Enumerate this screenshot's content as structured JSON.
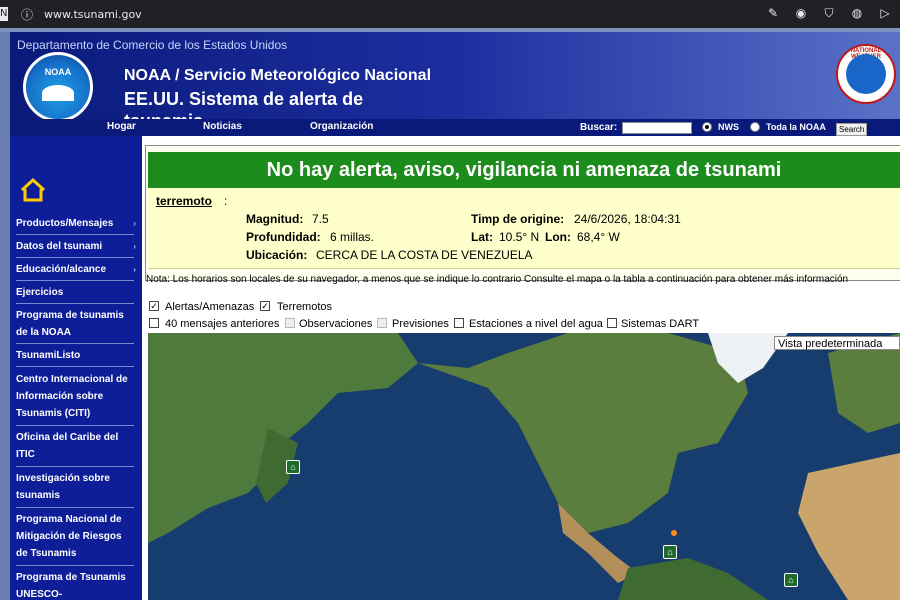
{
  "browser": {
    "url": "www.tsunami.gov",
    "info_icon": "info-icon",
    "actions": [
      "edit-icon",
      "camera-icon",
      "shield-icon",
      "globe-icon",
      "send-icon"
    ]
  },
  "header": {
    "department": "Departamento de Comercio de los Estados Unidos",
    "logo_text": "NOAA",
    "title_line1": "NOAA / Servicio Meteorológico Nacional",
    "title_line2": "EE.UU. Sistema de alerta de tsunamis",
    "nws_logo_text": "NATIONAL WEATHER SERVICE"
  },
  "nav": {
    "home": "Hogar",
    "news": "Noticias",
    "org": "Organización",
    "search_label": "Buscar:",
    "search_value": "",
    "radio_nws": "NWS",
    "radio_noaa": "Toda la NOAA",
    "search_button": "Search"
  },
  "sidebar": {
    "items": [
      {
        "label": "Productos/Mensajes",
        "arrow": "›"
      },
      {
        "label": "Datos del tsunami",
        "arrow": "›"
      },
      {
        "label": "Educación/alcance",
        "arrow": "›"
      },
      {
        "label": "Ejercicios",
        "arrow": ""
      },
      {
        "label": "Programa de tsunamis de la NOAA",
        "arrow": ""
      },
      {
        "label": "TsunamiListo",
        "arrow": ""
      },
      {
        "label": "Centro Internacional de Información sobre Tsunamis (CITI)",
        "arrow": ""
      },
      {
        "label": "Oficina del Caribe del ITIC",
        "arrow": ""
      },
      {
        "label": "Investigación sobre tsunamis",
        "arrow": ""
      },
      {
        "label": "Programa Nacional de Mitigación de Riesgos de Tsunamis",
        "arrow": ""
      },
      {
        "label": "Programa de Tsunamis UNESCO-",
        "arrow": ""
      }
    ]
  },
  "alert": {
    "banner": "No hay alerta, aviso, vigilancia ni amenaza de tsunami",
    "event_link": "terremoto",
    "event_colon": ":",
    "magnitude_label": "Magnitud:",
    "magnitude_value": "7.5",
    "origin_label": "Timp de origine:",
    "origin_value": "24/6/2026, 18:04:31",
    "depth_label": "Profundidad:",
    "depth_value": "6 millas.",
    "lat_label": "Lat:",
    "lat_value": "10.5° N",
    "lon_label": "Lon:",
    "lon_value": "68,4° W",
    "location_label": "Ubicación:",
    "location_value": "CERCA DE LA COSTA DE VENEZUELA"
  },
  "note": "Nota: Los horarios son locales de su navegador, a menos que se indique lo contrario   Consulte el mapa o la tabla a continuación para obtener más información",
  "layers": {
    "alerts": "Alertas/Amenazas",
    "quakes": "Terremotos",
    "previous": "40 mensajes anteriores",
    "observations": "Observaciones",
    "forecasts": "Previsiones",
    "stations": "Estaciones a nivel del agua",
    "dart": "Sistemas DART"
  },
  "map": {
    "view_select": "Vista predeterminada",
    "colors": {
      "ocean": "#173c6e",
      "land": "#4f7a3d",
      "ice": "#eef2f4",
      "desert": "#c9a56b",
      "pin": "#1f6b2a"
    }
  }
}
